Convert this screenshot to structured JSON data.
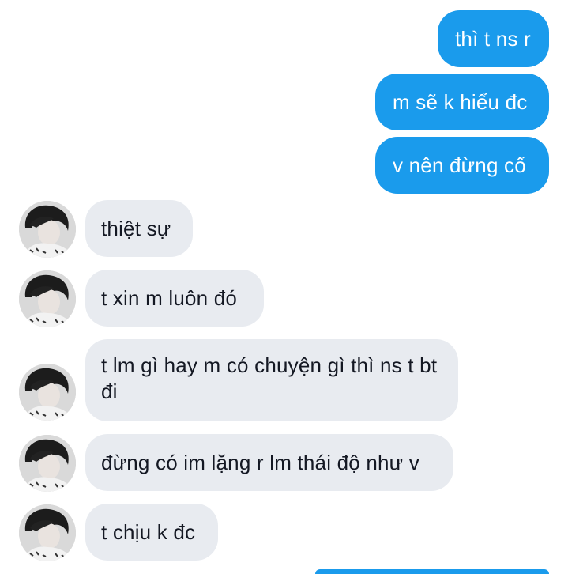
{
  "sent_messages": [
    {
      "text": "thì t ns r"
    },
    {
      "text": "m sẽ k hiểu đc"
    },
    {
      "text": "v nên đừng cố"
    }
  ],
  "received_messages": [
    {
      "text": "thiệt sự"
    },
    {
      "text": "t xin m luôn đó"
    },
    {
      "text": "t lm gì hay m có chuyện gì thì ns t bt đi"
    },
    {
      "text": "đừng có im lặng r lm thái độ như v"
    },
    {
      "text": "t chịu k đc"
    }
  ],
  "colors": {
    "sent_bubble": "#1a9bec",
    "received_bubble": "#e8ebf0",
    "background": "#ffffff"
  }
}
